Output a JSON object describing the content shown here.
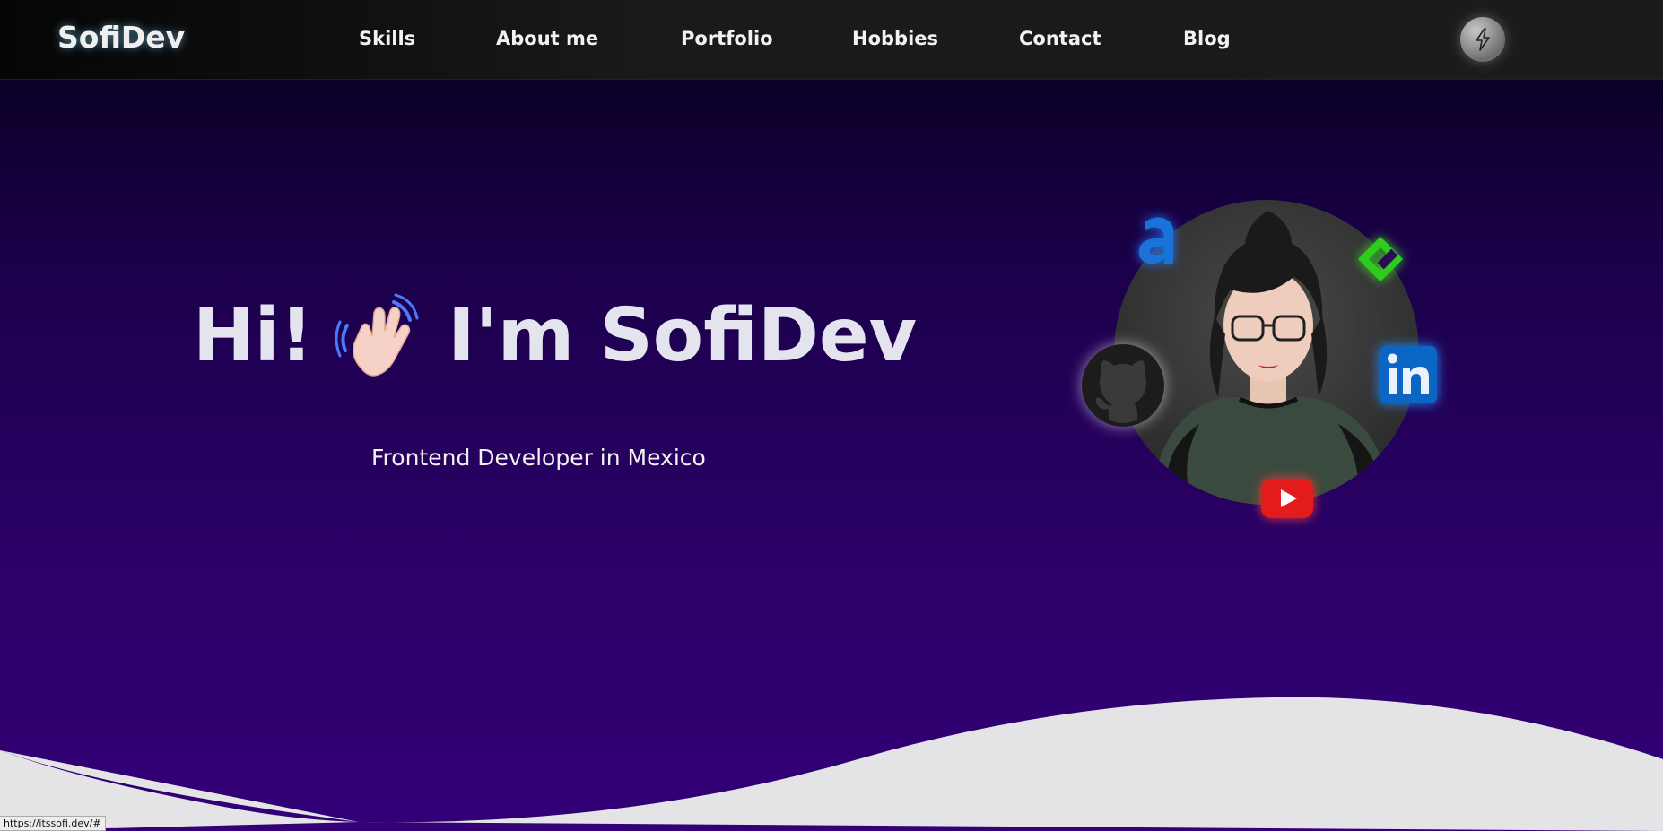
{
  "brand": {
    "name": "SofiDev"
  },
  "nav": {
    "links": [
      "Skills",
      "About me",
      "Portfolio",
      "Hobbies",
      "Contact",
      "Blog"
    ],
    "theme_toggle_icon": "lightning-icon"
  },
  "hero": {
    "greeting": "Hi!",
    "wave_emoji_icon": "waving-hand-icon",
    "name_line": "I'm SofiDev",
    "subtitle": "Frontend Developer in Mexico"
  },
  "profile": {
    "photo": "profile-photo",
    "socials": [
      {
        "name": "Amazon",
        "icon": "amazon-icon",
        "color": "#1a73d9"
      },
      {
        "name": "Codepen-like",
        "icon": "green-diamond-icon",
        "color": "#2ecc1c"
      },
      {
        "name": "GitHub",
        "icon": "github-icon",
        "color": "#222222"
      },
      {
        "name": "LinkedIn",
        "icon": "linkedin-icon",
        "color": "#0a66c2"
      },
      {
        "name": "YouTube",
        "icon": "youtube-icon",
        "color": "#e31b1b"
      }
    ]
  },
  "status_bar": {
    "url": "https://itssofi.dev/#"
  },
  "colors": {
    "background_top": "#05001a",
    "background_bottom": "#330077",
    "wave": "#e4e4e6",
    "nav_bg": "#161616"
  }
}
